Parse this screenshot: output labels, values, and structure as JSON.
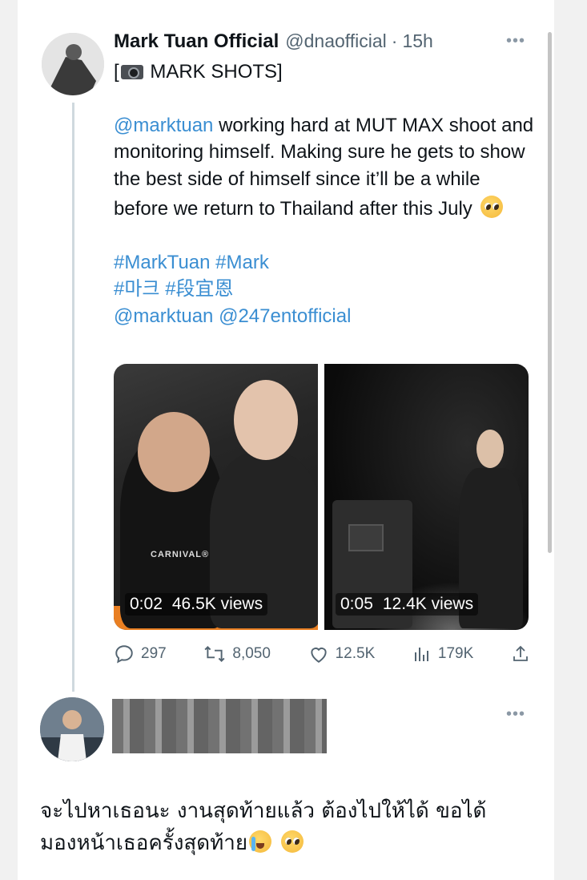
{
  "tweet": {
    "author_name": "Mark Tuan Official",
    "author_handle": "@dnaofficial",
    "separator": "·",
    "time": "15h",
    "more_icon": "•••",
    "title_prefix": "[",
    "title_text": " MARK SHOTS]",
    "body_mention": "@marktuan",
    "body_text": " working hard at MUT MAX shoot and monitoring himself. Making sure he gets to show the best side of himself since it’ll be a while before we return to Thailand after this July",
    "hashtag_line_1_a": "#MarkTuan",
    "hashtag_line_1_b": "#Mark",
    "hashtag_line_2_a": "#마크",
    "hashtag_line_2_b": "#段宜恩",
    "mention_line_a": "@marktuan",
    "mention_line_b": "@247entofficial",
    "emoji_after_body": "pleading-face-emoji"
  },
  "media": [
    {
      "duration": "0:02",
      "views": "46.5K views",
      "shirt_text": "CARNIVAL®"
    },
    {
      "duration": "0:05",
      "views": "12.4K views"
    }
  ],
  "actions": {
    "reply_count": "297",
    "retweet_count": "8,050",
    "like_count": "12.5K",
    "view_count": "179K"
  },
  "reply": {
    "more_icon": "•••",
    "text_line_1": "จะไปหาเธอนะ งานสุดท้ายแล้ว ต้องไปให้ได้ ขอได้",
    "text_line_2": "มองหน้าเธอครั้งสุดท้าย",
    "emojis": [
      "loudly-crying-face-emoji",
      "pleading-face-emoji"
    ]
  },
  "colors": {
    "link": "#3a8ed2",
    "text": "#0f1419",
    "muted": "#536471",
    "thread_line": "#cfd9de"
  }
}
